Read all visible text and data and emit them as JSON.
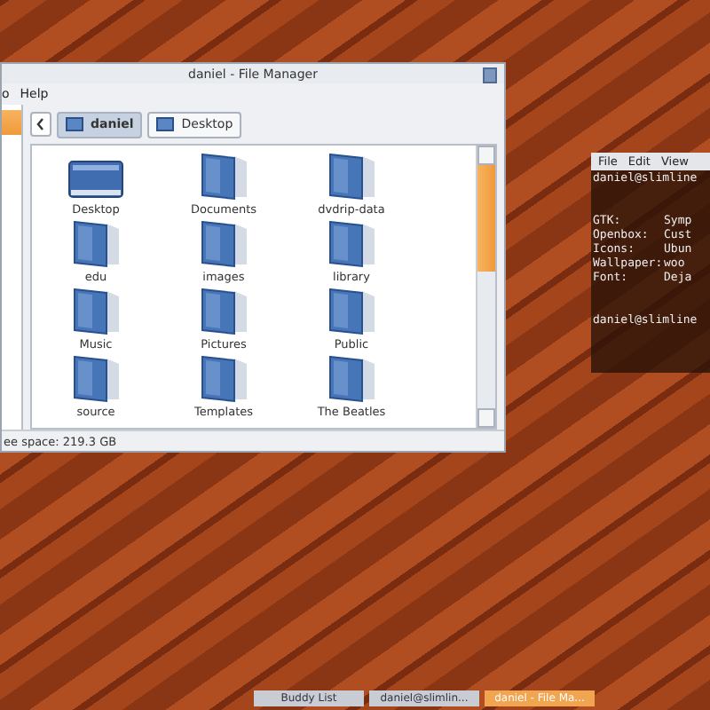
{
  "file_manager": {
    "title": "daniel - File Manager",
    "menu": [
      "o",
      "Help"
    ],
    "sidebar": {
      "items": [
        {
          "selected": true
        }
      ]
    },
    "breadcrumbs": [
      {
        "label": "daniel",
        "selected": true
      },
      {
        "label": "Desktop",
        "selected": false
      }
    ],
    "files": [
      {
        "name": "Desktop",
        "kind": "desktop"
      },
      {
        "name": "Documents",
        "kind": "folder"
      },
      {
        "name": "dvdrip-data",
        "kind": "folder"
      },
      {
        "name": "edu",
        "kind": "folder"
      },
      {
        "name": "images",
        "kind": "folder"
      },
      {
        "name": "library",
        "kind": "folder"
      },
      {
        "name": "Music",
        "kind": "folder"
      },
      {
        "name": "Pictures",
        "kind": "folder"
      },
      {
        "name": "Public",
        "kind": "folder"
      },
      {
        "name": "source",
        "kind": "folder"
      },
      {
        "name": "Templates",
        "kind": "folder"
      },
      {
        "name": "The Beatles",
        "kind": "folder"
      }
    ],
    "status_bar": "ee space: 219.3 GB"
  },
  "terminal": {
    "menu": [
      "File",
      "Edit",
      "View"
    ],
    "lines": [
      {
        "label": "daniel@slimline"
      },
      {
        "label": "GTK:",
        "value": "Symp"
      },
      {
        "label": "Openbox:",
        "value": "Cust"
      },
      {
        "label": "Icons:",
        "value": "Ubun"
      },
      {
        "label": "Wallpaper:",
        "value": "woo"
      },
      {
        "label": "Font:",
        "value": "Deja"
      },
      {
        "label": "daniel@slimline"
      }
    ]
  },
  "taskbar": [
    {
      "label": "Buddy List",
      "selected": false
    },
    {
      "label": "daniel@slimlin...",
      "selected": false
    },
    {
      "label": "daniel - File Ma...",
      "selected": true
    }
  ]
}
